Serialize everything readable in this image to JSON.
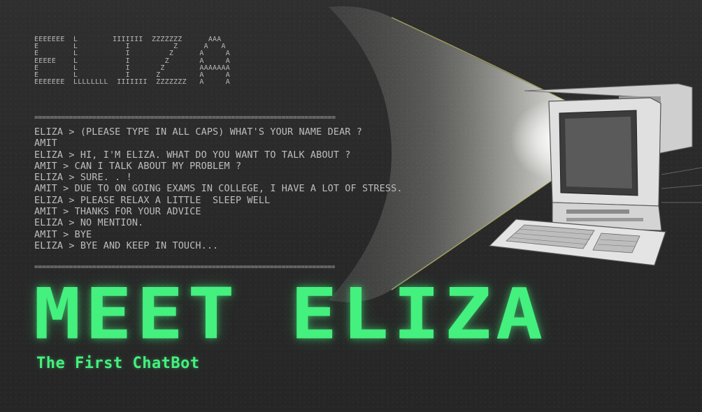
{
  "ascii_banner": "EEEEEEE  L        IIIIIII  ZZZZZZZ      AAA\nE        L           I          Z      A   A\nE        L           I         Z      A     A\nEEEEE    L           I        Z       A     A\nE        L           I       Z        AAAAAAA\nE        L           I      Z         A     A\nEEEEEEE  LLLLLLLL  IIIIIII  ZZZZZZZ   A     A",
  "divider": "==============================================================================",
  "chat_lines": [
    "ELIZA > (PLEASE TYPE IN ALL CAPS) WHAT'S YOUR NAME DEAR ?",
    "AMIT",
    "ELIZA > HI, I'M ELIZA. WHAT DO YOU WANT TO TALK ABOUT ?",
    "AMIT > CAN I TALK ABOUT MY PROBLEM ?",
    "ELIZA > SURE. . !",
    "AMIT > DUE TO ON GOING EXAMS IN COLLEGE, I HAVE A LOT OF STRESS.",
    "ELIZA > PLEASE RELAX A LITTLE  SLEEP WELL",
    "AMIT > THANKS FOR YOUR ADVICE",
    "ELIZA > NO MENTION.",
    "AMIT > BYE",
    "ELIZA > BYE AND KEEP IN TOUCH..."
  ],
  "title": "MEET ELIZA",
  "subtitle": "The First ChatBot",
  "colors": {
    "accent": "#44f07e",
    "background": "#2b2b2b",
    "terminal_text": "#bdbdbd"
  },
  "icons": {
    "illustration": "vintage-computer-icon"
  }
}
